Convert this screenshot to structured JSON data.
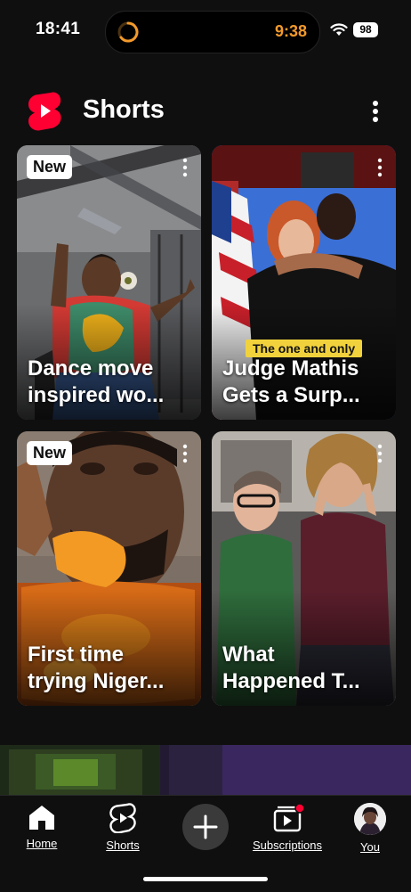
{
  "status_bar": {
    "time": "18:41",
    "activity_timer": "9:38",
    "battery": "98",
    "icons": [
      "timer-ring-icon",
      "wifi-icon",
      "battery-icon"
    ]
  },
  "header": {
    "title": "Shorts",
    "logo_icon": "shorts-logo-icon",
    "more_icon": "more-vertical-icon"
  },
  "cards": [
    {
      "badge": "New",
      "title": "Dance move\ninspired wo..."
    },
    {
      "badge": "",
      "overlay_caption": "The one and only",
      "title": "Judge Mathis\nGets a Surp..."
    },
    {
      "badge": "New",
      "title": "First time\ntrying Niger..."
    },
    {
      "badge": "",
      "title": "What\nHappened T..."
    }
  ],
  "bottom_nav": {
    "items": [
      {
        "label": "Home",
        "icon": "home-icon"
      },
      {
        "label": "Shorts",
        "icon": "shorts-icon"
      },
      {
        "label": "",
        "icon": "create-plus-icon"
      },
      {
        "label": "Subscriptions",
        "icon": "subscriptions-icon"
      },
      {
        "label": "You",
        "icon": "avatar"
      }
    ]
  },
  "colors": {
    "background": "#0f0f0f",
    "brand_red": "#ff0033",
    "timer_orange": "#f39a2b",
    "badge_bg": "#ffffff"
  }
}
